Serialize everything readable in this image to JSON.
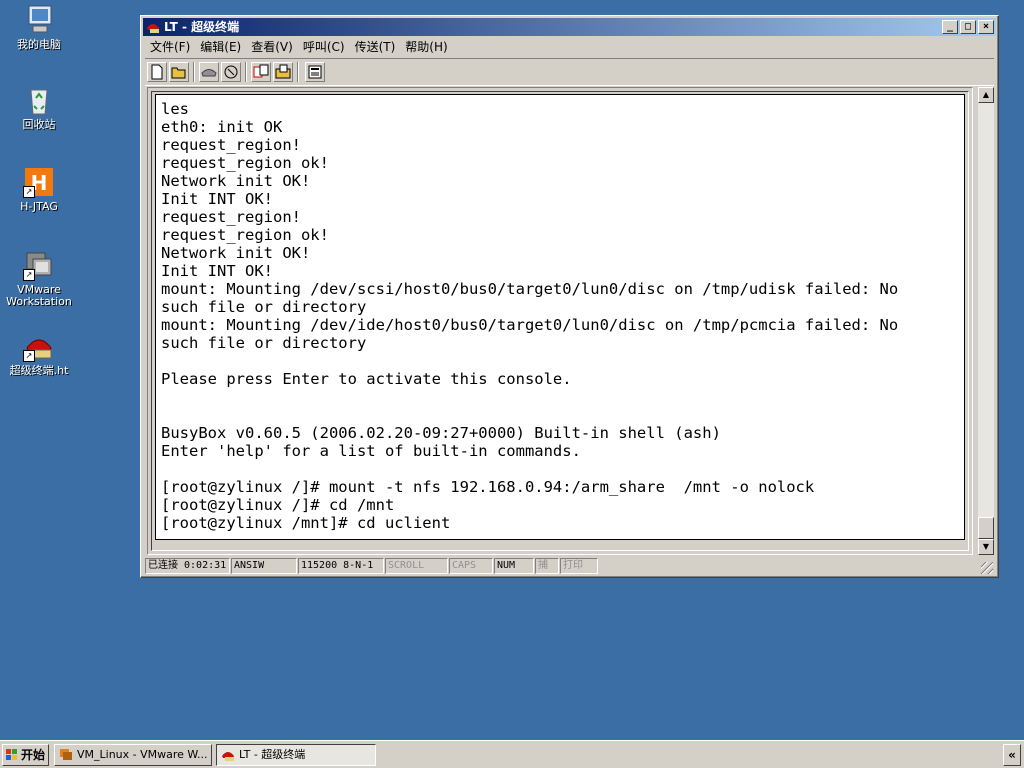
{
  "desktop": {
    "icons": [
      {
        "label": "我的电脑",
        "icon": "my-computer-icon"
      },
      {
        "label": "回收站",
        "icon": "recycle-bin-icon"
      },
      {
        "label": "H-JTAG",
        "icon": "h-jtag-icon"
      },
      {
        "label": "VMware\nWorkstation",
        "icon": "vmware-icon"
      },
      {
        "label": "超级终端.ht",
        "icon": "hyperterminal-icon"
      }
    ]
  },
  "window": {
    "title": "LT - 超级终端",
    "buttons": {
      "minimize": "_",
      "maximize": "□",
      "close": "×"
    },
    "menu": [
      "文件(F)",
      "编辑(E)",
      "查看(V)",
      "呼叫(C)",
      "传送(T)",
      "帮助(H)"
    ],
    "toolbar": [
      "new-icon",
      "open-icon",
      "phone-icon",
      "disconnect-icon",
      "send-icon",
      "receive-icon",
      "properties-icon"
    ],
    "terminal_lines": [
      "les",
      "eth0: init OK",
      "request_region!",
      "request_region ok!",
      "Network init OK!",
      "Init INT OK!",
      "request_region!",
      "request_region ok!",
      "Network init OK!",
      "Init INT OK!",
      "mount: Mounting /dev/scsi/host0/bus0/target0/lun0/disc on /tmp/udisk failed: No",
      "such file or directory",
      "mount: Mounting /dev/ide/host0/bus0/target0/lun0/disc on /tmp/pcmcia failed: No",
      "such file or directory",
      "",
      "Please press Enter to activate this console.",
      "",
      "",
      "BusyBox v0.60.5 (2006.02.20-09:27+0000) Built-in shell (ash)",
      "Enter 'help' for a list of built-in commands.",
      "",
      "[root@zylinux /]# mount -t nfs 192.168.0.94:/arm_share  /mnt -o nolock",
      "[root@zylinux /]# cd /mnt",
      "[root@zylinux /mnt]# cd uclient"
    ],
    "status": {
      "connection": "已连接 0:02:31",
      "emulation": "ANSIW",
      "settings": "115200 8-N-1",
      "scroll": "SCROLL",
      "caps": "CAPS",
      "num": "NUM",
      "capture": "捕",
      "print": "打印"
    }
  },
  "taskbar": {
    "start": "开始",
    "tasks": [
      "VM_Linux - VMware W...",
      "LT - 超级终端"
    ],
    "tray_toggle": "«"
  }
}
